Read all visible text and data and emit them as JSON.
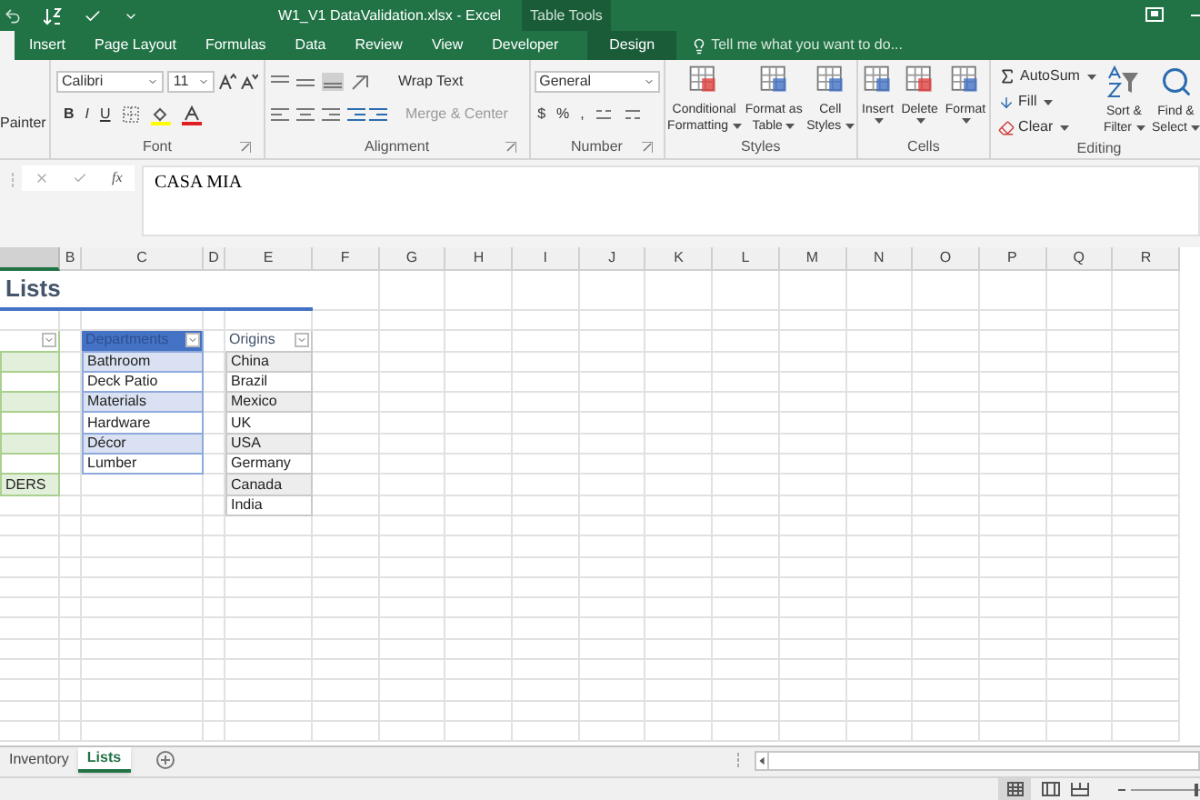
{
  "window": {
    "title": "W1_V1 DataValidation.xlsx - Excel",
    "context_label": "Table Tools"
  },
  "ribbon_tabs": [
    {
      "label": "Insert",
      "kind": "normal"
    },
    {
      "label": "Page Layout",
      "kind": "normal"
    },
    {
      "label": "Formulas",
      "kind": "normal"
    },
    {
      "label": "Data",
      "kind": "normal"
    },
    {
      "label": "Review",
      "kind": "normal"
    },
    {
      "label": "View",
      "kind": "normal"
    },
    {
      "label": "Developer",
      "kind": "normal"
    },
    {
      "label": "Design",
      "kind": "contextual"
    }
  ],
  "tell_me": {
    "placeholder": "Tell me what you want to do..."
  },
  "clipboard": {
    "painter": "Painter"
  },
  "font_group": {
    "font_name": "Calibri",
    "font_size": "11",
    "bold": "B",
    "italic": "I",
    "underline": "U",
    "label": "Font"
  },
  "alignment_group": {
    "wrap": "Wrap Text",
    "merge": "Merge & Center",
    "label": "Alignment"
  },
  "number_group": {
    "format": "General",
    "currency": "$",
    "percent": "%",
    "comma": ",",
    "label": "Number"
  },
  "styles_group": {
    "buttons": [
      {
        "line1": "Conditional",
        "line2": "Formatting"
      },
      {
        "line1": "Format as",
        "line2": "Table"
      },
      {
        "line1": "Cell",
        "line2": "Styles"
      }
    ],
    "label": "Styles"
  },
  "cells_group": {
    "buttons": [
      "Insert",
      "Delete",
      "Format"
    ],
    "label": "Cells"
  },
  "editing_group": {
    "autosum": "AutoSum",
    "fill": "Fill",
    "clear": "Clear",
    "sort": {
      "line1": "Sort &",
      "line2": "Filter"
    },
    "find": {
      "line1": "Find &",
      "line2": "Select"
    },
    "label": "Editing"
  },
  "formula_bar": {
    "fx_label": "fx",
    "value": "CASA MIA"
  },
  "sheet": {
    "columns": [
      "B",
      "C",
      "D",
      "E",
      "F",
      "G",
      "H",
      "I",
      "J",
      "K",
      "L",
      "M",
      "N",
      "O",
      "P",
      "Q",
      "R"
    ],
    "title": "Lists",
    "tables": [
      {
        "kind": "green",
        "items": [
          "DERS"
        ]
      },
      {
        "kind": "blue",
        "header": "Departments",
        "items": [
          "Bathroom",
          "Deck Patio",
          "Materials",
          "Hardware",
          "Décor",
          "Lumber"
        ]
      },
      {
        "kind": "gray",
        "header": "Origins",
        "items": [
          "China",
          "Brazil",
          "Mexico",
          "UK",
          "USA",
          "Germany",
          "Canada",
          "India"
        ]
      }
    ]
  },
  "sheet_tabs": [
    {
      "label": "Inventory",
      "selected": false
    },
    {
      "label": "Lists",
      "selected": true
    }
  ],
  "zoom": {
    "level": 0.95
  }
}
